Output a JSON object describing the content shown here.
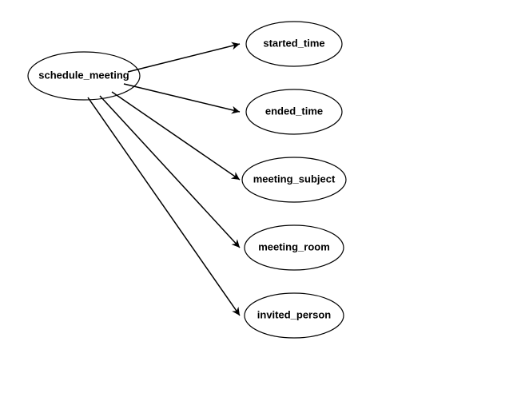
{
  "diagram": {
    "root": {
      "label": "schedule_meeting"
    },
    "children": [
      {
        "label": "started_time"
      },
      {
        "label": "ended_time"
      },
      {
        "label": "meeting_subject"
      },
      {
        "label": "meeting_room"
      },
      {
        "label": "invited_person"
      }
    ]
  }
}
